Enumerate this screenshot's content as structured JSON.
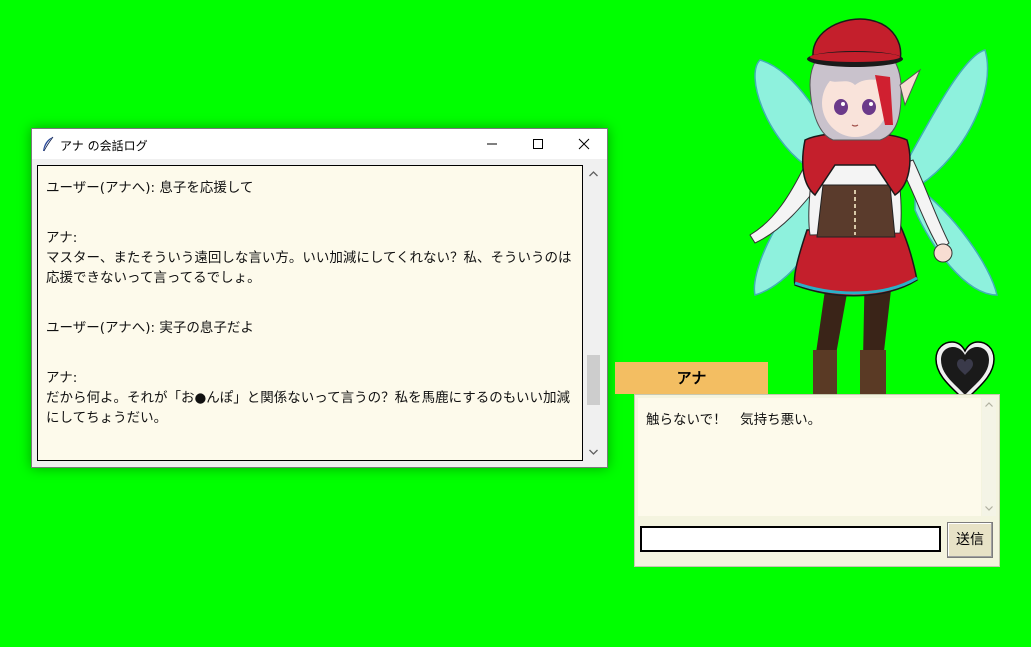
{
  "log_window": {
    "title": "アナ の会話ログ",
    "entries": [
      {
        "speaker": "user",
        "text": "ユーザー(アナへ): 息子を応援して"
      },
      {
        "speaker": "ana",
        "text": "アナ:\nマスター、またそういう遠回しな言い方。いい加減にしてくれない？私、そういうのは応援できないって言ってるでしょ。"
      },
      {
        "speaker": "user",
        "text": "ユーザー(アナへ): 実子の息子だよ"
      },
      {
        "speaker": "ana",
        "text": "アナ:\nだから何よ。それが「お●んぽ」と関係ないって言うの？私を馬鹿にするのもいい加減にしてちょうだい。"
      }
    ],
    "scroll_position": 0.65
  },
  "character": {
    "name": "アナ",
    "icon": "fairy-girl-portrait",
    "affection_icon": "heart-icon"
  },
  "chat": {
    "message": "触らないで！　気持ち悪い。",
    "input_value": "",
    "send_label": "送信"
  },
  "colors": {
    "background": "#00ff00",
    "name_tag": "#f3be62",
    "text_area": "#fdfaeb"
  }
}
